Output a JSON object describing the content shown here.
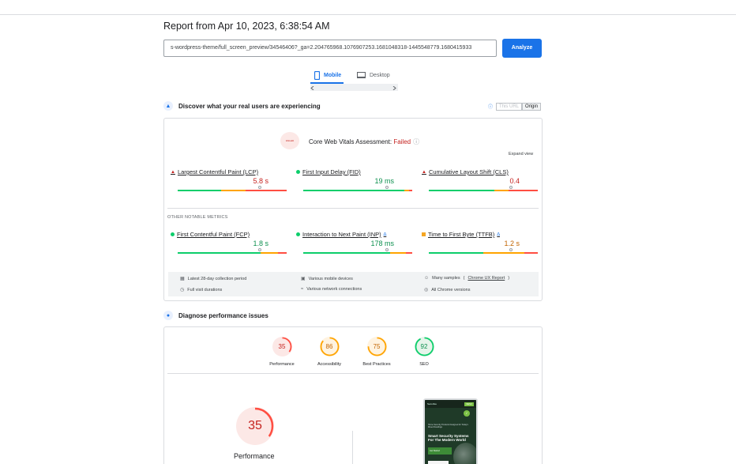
{
  "report": {
    "title": "Report from Apr 10, 2023, 6:38:54 AM",
    "url_value": "s-wordpress-theme/full_screen_preview/34546406?_ga=2.204765968.1076907253.1681048318-1445548779.1680415933",
    "analyze_label": "Analyze"
  },
  "device_tabs": [
    {
      "label": "Mobile",
      "icon": "mobile-phone-icon",
      "active": true
    },
    {
      "label": "Desktop",
      "icon": "desktop-monitor-icon",
      "active": false
    }
  ],
  "field_section": {
    "title": "Discover what your real users are experiencing",
    "icon": "users-icon",
    "toggle": {
      "info_icon": "info-icon",
      "this_url": "This URL",
      "origin": "Origin"
    },
    "assessment": {
      "badge_text": "FAILED",
      "prefix": "Core Web Vitals Assessment: ",
      "result": "Failed",
      "help_icon": "help-circle-icon"
    },
    "expand_label": "Expand view",
    "other_label": "OTHER NOTABLE METRICS",
    "core_metrics": [
      {
        "name": "Largest Contentful Paint (LCP)",
        "value": "5.8 s",
        "indicator": "triangle",
        "status": "poor",
        "bar": [
          0.4,
          0.22,
          0.38
        ],
        "marker": 0.74
      },
      {
        "name": "First Input Delay (FID)",
        "value": "19 ms",
        "indicator": "dot",
        "status": "good",
        "bar": [
          0.93,
          0.04,
          0.03
        ],
        "marker": 0.75
      },
      {
        "name": "Cumulative Layout Shift (CLS)",
        "value": "0.4",
        "indicator": "triangle",
        "status": "poor",
        "bar": [
          0.6,
          0.13,
          0.27
        ],
        "marker": 0.74
      }
    ],
    "other_metrics": [
      {
        "name": "First Contentful Paint (FCP)",
        "value": "1.8 s",
        "indicator": "dot",
        "status": "good",
        "bar": [
          0.76,
          0.16,
          0.08
        ],
        "marker": 0.74,
        "beta": false
      },
      {
        "name": "Interaction to Next Paint (INP)",
        "value": "178 ms",
        "indicator": "dot",
        "status": "good",
        "bar": [
          0.8,
          0.14,
          0.06
        ],
        "marker": 0.75,
        "beta": true
      },
      {
        "name": "Time to First Byte (TTFB)",
        "value": "1.2 s",
        "indicator": "square",
        "status": "avg",
        "bar": [
          0.5,
          0.38,
          0.12
        ],
        "marker": 0.74,
        "beta": true
      }
    ],
    "footer": [
      {
        "icon": "calendar-icon",
        "text": "Latest 28-day collection period"
      },
      {
        "icon": "devices-icon",
        "text": "Various mobile devices"
      },
      {
        "icon": "users-group-icon",
        "text": "Many samples",
        "link": "Chrome UX Report"
      },
      {
        "icon": "timer-icon",
        "text": "Full visit durations"
      },
      {
        "icon": "wifi-icon",
        "text": "Various network connections"
      },
      {
        "icon": "chrome-icon",
        "text": "All Chrome versions"
      }
    ]
  },
  "lab_section": {
    "title": "Diagnose performance issues",
    "icon": "lab-flask-icon",
    "scores": [
      {
        "value": "35",
        "label": "Performance",
        "status": "red"
      },
      {
        "value": "86",
        "label": "Accessibility",
        "status": "orange"
      },
      {
        "value": "75",
        "label": "Best Practices",
        "status": "orange"
      },
      {
        "value": "92",
        "label": "SEO",
        "status": "green"
      }
    ],
    "big_score": {
      "value": "35",
      "label": "Performance"
    },
    "preview": {
      "headline": "Smart Security Systems For The Modern World",
      "small_text": "Home Security Products Designed for Today's Mixed Dwellings",
      "cta": "Get Started",
      "brand": "Securika",
      "nav_button": "MENU"
    }
  },
  "colors": {
    "accent": "#1a73e8",
    "good": "#0cce6b",
    "average": "#ffa400",
    "poor": "#ff4e42"
  }
}
